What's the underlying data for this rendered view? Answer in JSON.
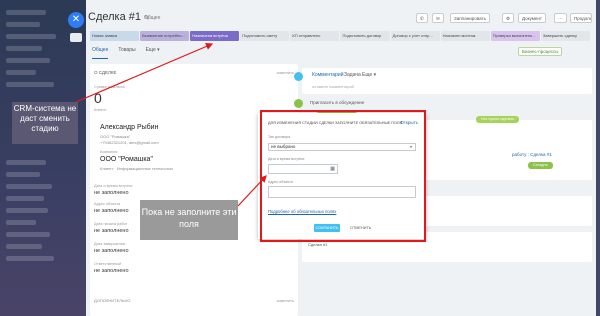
{
  "deal": {
    "title": "Сделка #1",
    "pen": "✎",
    "category": "Общее"
  },
  "toolbar": {
    "phone": "✆",
    "mail": "✉",
    "plan": "Запланировать",
    "settings": "⚙",
    "document": "Документ",
    "more": "⋯",
    "continue": "Продолжение"
  },
  "stages": [
    "Новая заявка",
    "Выявление потребно...",
    "Назначена встреча",
    "Подготовить смету",
    "КП отправлено",
    "Подготовить договор",
    "Договор с учет отпр...",
    "Назначен монтаж",
    "Проверка выполнено...",
    "Завершить сделку"
  ],
  "tabs": [
    "Общее",
    "Товары",
    "Еще ▾"
  ],
  "biz_button": "Бизнес-процессы",
  "deal_block": {
    "section_label": "О СДЕЛКЕ",
    "edit": "изменить",
    "sum_label": "Сумма и валюта",
    "sum": "0",
    "client_label": "Клиент",
    "contact1_name": "Александр Рыбин",
    "contact1_company": "ООО \"Ромашка\"",
    "contact1_phone": "+79462321201, alex@gmail.com",
    "company_label": "Компания",
    "contact2_name": "ООО \"Ромашка\"",
    "contact2_sub": "Клиент · Информационные технологии",
    "f1_label": "Дата и время встречи",
    "f1_val": "не заполнено",
    "f2_label": "Адрес объекта",
    "f2_val": "не заполнено",
    "f3_label": "Дата начала работ",
    "f3_val": "не заполнено",
    "f4_label": "Дата завершения",
    "f4_val": "не заполнено",
    "f5_label": "Ответственный",
    "f5_val": "не заполнено",
    "add_section": "ДОПОЛНИТЕЛЬНО",
    "add_edit": "изменить"
  },
  "feed": {
    "tab_comment": "Комментарий",
    "tab_task": "Задача",
    "tab_more": "Еще ▾",
    "placeholder": "оставьте комментарий",
    "invite": "Пригласить в обсуждение",
    "planned_pill": "Запланированное",
    "task_pill": "Что нужно сделать",
    "task_link": "работу : Сделка #1",
    "today_pill": "Сегодня",
    "deal_ref": "Сделка #1"
  },
  "modal": {
    "title": "ДЛЯ ИЗМЕНЕНИЯ СТАДИИ СДЕЛКИ ЗАПОЛНИТЕ ОБЯЗАТЕЛЬНЫЕ ПОЛЯ",
    "open": "Открыть",
    "type_label": "Тип договора",
    "type_value": "не выбрано",
    "date_label": "Дата и время встречи",
    "addr_label": "Адрес объекта",
    "more_link": "Подробнее об обязательных полях",
    "save": "СОХРАНИТЬ",
    "cancel": "ОТМЕНИТЬ"
  },
  "annotations": {
    "left": "CRM-система не даст сменить стадию",
    "middle": "Пока не заполните эти поля"
  },
  "left_panel": {
    "close": "✕"
  },
  "colors": {
    "accent": "#2067b0",
    "annotation_red": "#e11919",
    "save": "#43c0f2"
  }
}
